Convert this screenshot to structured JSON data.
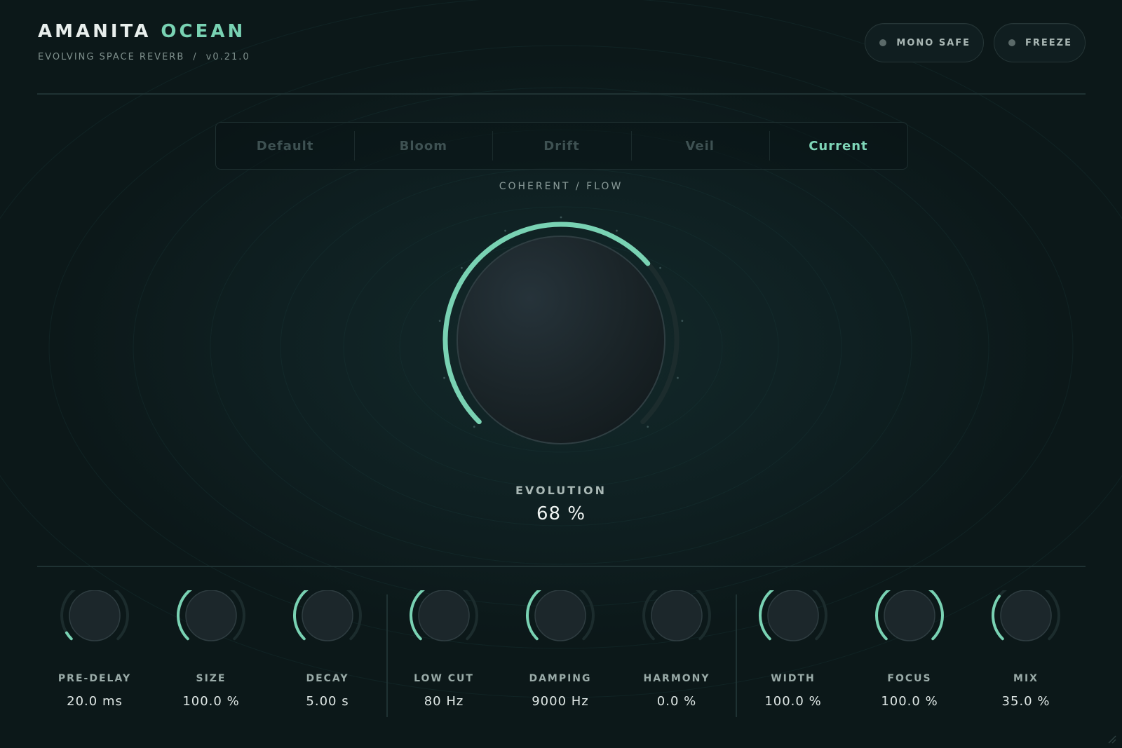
{
  "brand": {
    "name": "AMANITA",
    "name_accent": "OCEAN",
    "subtitle": "EVOLVING SPACE REVERB",
    "separator": "/",
    "version": "v0.21.0"
  },
  "toggles": [
    {
      "label": "MONO SAFE",
      "on": false
    },
    {
      "label": "FREEZE",
      "on": false
    }
  ],
  "presets": {
    "items": [
      "Default",
      "Bloom",
      "Drift",
      "Veil",
      "Current"
    ],
    "active": "Current"
  },
  "mode_label": "COHERENT / FLOW",
  "main_knob": {
    "label": "EVOLUTION",
    "value_text": "68 %",
    "value": 0.68
  },
  "knobs": [
    {
      "label": "PRE-DELAY",
      "value_text": "20.0 ms",
      "value": 0.05
    },
    {
      "label": "SIZE",
      "value_text": "100.0 %",
      "value": 0.45
    },
    {
      "label": "DECAY",
      "value_text": "5.00 s",
      "value": 0.55
    },
    {
      "label": "LOW CUT",
      "value_text": "80 Hz",
      "value": 0.38
    },
    {
      "label": "DAMPING",
      "value_text": "9000 Hz",
      "value": 0.56
    },
    {
      "label": "HARMONY",
      "value_text": "0.0 %",
      "value": 0.0
    },
    {
      "label": "WIDTH",
      "value_text": "100.0 %",
      "value": 0.45
    },
    {
      "label": "FOCUS",
      "value_text": "100.0 %",
      "value": 1.0
    },
    {
      "label": "MIX",
      "value_text": "35.0 %",
      "value": 0.3
    }
  ],
  "colors": {
    "accent": "#79d2b3",
    "track": "#1c2c2d",
    "background": "#0c1819"
  }
}
